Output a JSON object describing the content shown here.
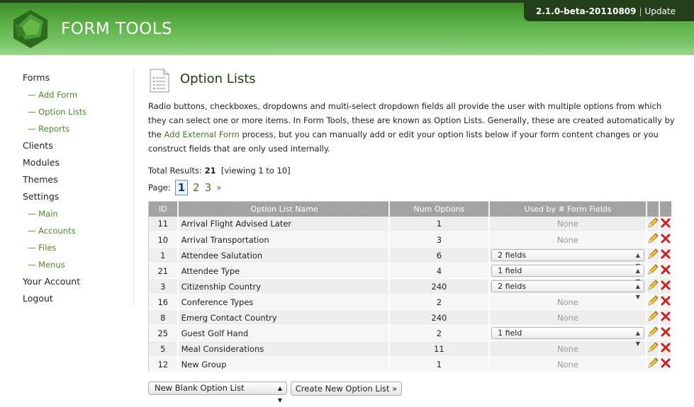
{
  "header": {
    "logo_text": "FORM TOOLS",
    "version": "2.1.0-beta-20110809",
    "separator": "|",
    "update_label": "Update"
  },
  "sidebar": {
    "items": [
      {
        "label": "Forms",
        "sub": false
      },
      {
        "label": "Add Form",
        "sub": true
      },
      {
        "label": "Option Lists",
        "sub": true
      },
      {
        "label": "Reports",
        "sub": true
      },
      {
        "label": "Clients",
        "sub": false
      },
      {
        "label": "Modules",
        "sub": false
      },
      {
        "label": "Themes",
        "sub": false
      },
      {
        "label": "Settings",
        "sub": false
      },
      {
        "label": "Main",
        "sub": true
      },
      {
        "label": "Accounts",
        "sub": true
      },
      {
        "label": "Files",
        "sub": true
      },
      {
        "label": "Menus",
        "sub": true
      },
      {
        "label": "Your Account",
        "sub": false
      },
      {
        "label": "Logout",
        "sub": false
      }
    ]
  },
  "main": {
    "title": "Option Lists",
    "intro_part1": "Radio buttons, checkboxes, dropdowns and multi-select dropdown fields all provide the user with multiple options from which they can select one or more items. In Form Tools, these are known as Option Lists. Generally, these are created automatically by the ",
    "intro_link": "Add External Form",
    "intro_part2": " process, but you can manually add or edit your option lists below if your form content changes or you construct fields that are only used internally.",
    "total_label": "Total Results:",
    "total_count": "21",
    "viewing": "[viewing 1 to 10]",
    "page_label": "Page:",
    "pages": [
      "1",
      "2",
      "3"
    ],
    "next_label": "»"
  },
  "table": {
    "headers": {
      "id": "ID",
      "name": "Option List Name",
      "num": "Num Options",
      "used": "Used by # Form Fields"
    },
    "rows": [
      {
        "id": "11",
        "name": "Arrival Flight Advised Later",
        "num": "1",
        "used": "None",
        "used_type": "text"
      },
      {
        "id": "10",
        "name": "Arrival Transportation",
        "num": "3",
        "used": "None",
        "used_type": "text"
      },
      {
        "id": "1",
        "name": "Attendee Salutation",
        "num": "6",
        "used": "2 fields",
        "used_type": "select"
      },
      {
        "id": "21",
        "name": "Attendee Type",
        "num": "4",
        "used": "1 field",
        "used_type": "select"
      },
      {
        "id": "3",
        "name": "Citizenship Country",
        "num": "240",
        "used": "2 fields",
        "used_type": "select"
      },
      {
        "id": "16",
        "name": "Conference Types",
        "num": "2",
        "used": "None",
        "used_type": "text"
      },
      {
        "id": "8",
        "name": "Emerg Contact Country",
        "num": "240",
        "used": "None",
        "used_type": "text"
      },
      {
        "id": "25",
        "name": "Guest Golf Hand",
        "num": "2",
        "used": "1 field",
        "used_type": "select"
      },
      {
        "id": "5",
        "name": "Meal Considerations",
        "num": "11",
        "used": "None",
        "used_type": "text"
      },
      {
        "id": "12",
        "name": "New Group",
        "num": "1",
        "used": "None",
        "used_type": "text"
      }
    ]
  },
  "footer_controls": {
    "select_value": "New Blank Option List",
    "create_button": "Create New Option List »"
  },
  "colors": {
    "header_dark": "#23401b",
    "header_green": "#5cb146",
    "link_green": "#3d7d22",
    "delete_red": "#cc1f1f"
  },
  "icons": [
    "logo-gem-icon",
    "page-list-icon",
    "pencil-icon",
    "delete-x-icon",
    "chevron-updown-icon"
  ]
}
